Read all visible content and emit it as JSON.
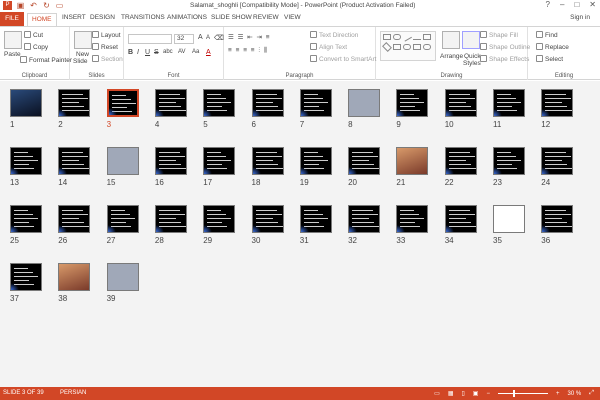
{
  "window": {
    "title": "Salamat_shoghli [Compatibility Mode] - PowerPoint (Product Activation Failed)",
    "controls": [
      "?",
      "–",
      "□",
      "✕"
    ]
  },
  "tabs": [
    "FILE",
    "HOME",
    "INSERT",
    "DESIGN",
    "TRANSITIONS",
    "ANIMATIONS",
    "SLIDE SHOW",
    "REVIEW",
    "VIEW"
  ],
  "active_tab": "HOME",
  "signin": "Sign in",
  "ribbon": {
    "clipboard": {
      "paste": "Paste",
      "cut": "Cut",
      "copy": "Copy",
      "format_painter": "Format Painter",
      "label": "Clipboard"
    },
    "slides": {
      "new_slide": "New",
      "new_slide2": "Slide",
      "layout": "Layout",
      "reset": "Reset",
      "section": "Section",
      "label": "Slides"
    },
    "font": {
      "size": "32",
      "label": "Font",
      "bold": "B",
      "italic": "I",
      "underline": "U",
      "strike": "S",
      "shadow": "abc",
      "spacing": "AV",
      "case": "Aa",
      "color": "A"
    },
    "paragraph": {
      "text_direction": "Text Direction",
      "align_text": "Align Text",
      "smartart": "Convert to SmartArt",
      "label": "Paragraph"
    },
    "drawing": {
      "arrange": "Arrange",
      "quick_styles": "Quick",
      "quick_styles2": "Styles",
      "shape_fill": "Shape Fill",
      "shape_outline": "Shape Outline",
      "shape_effects": "Shape Effects",
      "label": "Drawing"
    },
    "editing": {
      "find": "Find",
      "replace": "Replace",
      "select": "Select",
      "label": "Editing"
    }
  },
  "slides": [
    {
      "n": "1",
      "kind": "photo-dark"
    },
    {
      "n": "2"
    },
    {
      "n": "3",
      "selected": true
    },
    {
      "n": "4"
    },
    {
      "n": "5"
    },
    {
      "n": "6"
    },
    {
      "n": "7"
    },
    {
      "n": "8",
      "kind": "photo"
    },
    {
      "n": "9"
    },
    {
      "n": "10"
    },
    {
      "n": "11"
    },
    {
      "n": "12"
    },
    {
      "n": "13"
    },
    {
      "n": "14"
    },
    {
      "n": "15",
      "kind": "photo"
    },
    {
      "n": "16"
    },
    {
      "n": "17"
    },
    {
      "n": "18"
    },
    {
      "n": "19"
    },
    {
      "n": "20"
    },
    {
      "n": "21",
      "kind": "photo-warm"
    },
    {
      "n": "22"
    },
    {
      "n": "23"
    },
    {
      "n": "24"
    },
    {
      "n": "25"
    },
    {
      "n": "26"
    },
    {
      "n": "27"
    },
    {
      "n": "28"
    },
    {
      "n": "29"
    },
    {
      "n": "30"
    },
    {
      "n": "31"
    },
    {
      "n": "32"
    },
    {
      "n": "33"
    },
    {
      "n": "34"
    },
    {
      "n": "35",
      "kind": "white"
    },
    {
      "n": "36"
    },
    {
      "n": "37"
    },
    {
      "n": "38",
      "kind": "photo-warm"
    },
    {
      "n": "39",
      "kind": "photo"
    }
  ],
  "status": {
    "slide": "SLIDE 3 OF 39",
    "language": "PERSIAN",
    "zoom": "30 %"
  }
}
